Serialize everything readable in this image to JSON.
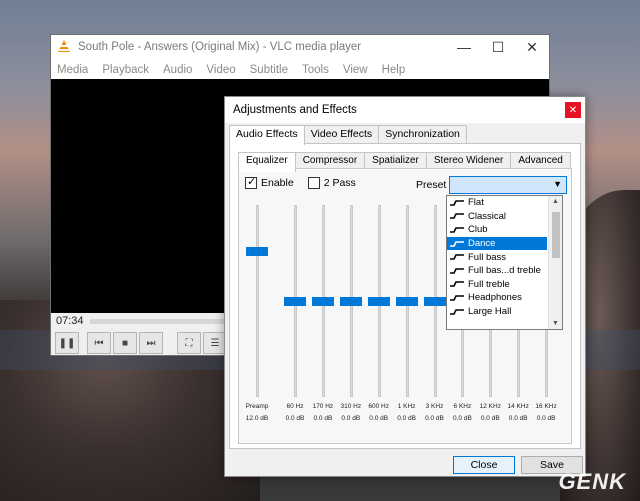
{
  "vlc": {
    "title": "South Pole - Answers (Original Mix) - VLC media player",
    "menu": [
      "Media",
      "Playback",
      "Audio",
      "Video",
      "Subtitle",
      "Tools",
      "View",
      "Help"
    ],
    "time": "07:34"
  },
  "dialog": {
    "title": "Adjustments and Effects",
    "tabs": [
      "Audio Effects",
      "Video Effects",
      "Synchronization"
    ],
    "audio_tabs": [
      "Equalizer",
      "Compressor",
      "Spatializer",
      "Stereo Widener",
      "Advanced"
    ],
    "enable_label": "Enable",
    "enable_checked": true,
    "twopass_label": "2 Pass",
    "twopass_checked": false,
    "preset_label": "Preset",
    "preamp": {
      "label": "Preamp",
      "db": "12.0 dB",
      "level": 0.76
    },
    "bands": [
      {
        "freq": "60 Hz",
        "db": "0.0 dB",
        "level": 0.5
      },
      {
        "freq": "170 Hz",
        "db": "0.0 dB",
        "level": 0.5
      },
      {
        "freq": "310 Hz",
        "db": "0.0 dB",
        "level": 0.5
      },
      {
        "freq": "600 Hz",
        "db": "0.0 dB",
        "level": 0.5
      },
      {
        "freq": "1 KHz",
        "db": "0.0 dB",
        "level": 0.5
      },
      {
        "freq": "3 KHz",
        "db": "0.0 dB",
        "level": 0.5
      },
      {
        "freq": "6 KHz",
        "db": "0.0 dB",
        "level": 0.5
      },
      {
        "freq": "12 KHz",
        "db": "0.0 dB",
        "level": 0.5
      },
      {
        "freq": "14 KHz",
        "db": "0.0 dB",
        "level": 0.5
      },
      {
        "freq": "16 KHz",
        "db": "0.0 dB",
        "level": 0.5
      }
    ],
    "presets": [
      "Flat",
      "Classical",
      "Club",
      "Dance",
      "Full bass",
      "Full bas...d treble",
      "Full treble",
      "Headphones",
      "Large Hall"
    ],
    "selected_preset": "Dance",
    "close_label": "Close",
    "save_label": "Save"
  },
  "watermark": "GENK",
  "colors": {
    "accent": "#0078d7",
    "close": "#e81123",
    "vlc_cone": "#f28c00"
  }
}
